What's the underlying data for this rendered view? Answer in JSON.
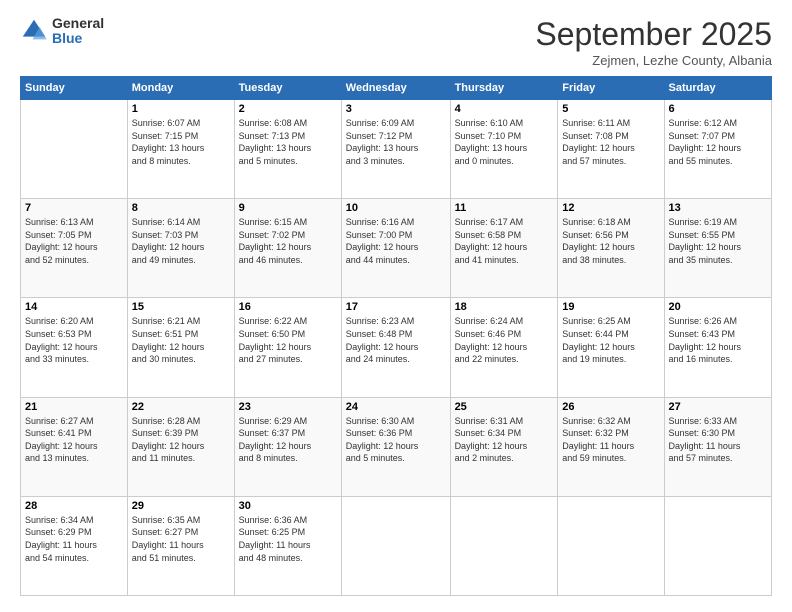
{
  "header": {
    "logo_general": "General",
    "logo_blue": "Blue",
    "month_title": "September 2025",
    "location": "Zejmen, Lezhe County, Albania"
  },
  "calendar": {
    "days_of_week": [
      "Sunday",
      "Monday",
      "Tuesday",
      "Wednesday",
      "Thursday",
      "Friday",
      "Saturday"
    ],
    "weeks": [
      [
        {
          "day": "",
          "info": ""
        },
        {
          "day": "1",
          "info": "Sunrise: 6:07 AM\nSunset: 7:15 PM\nDaylight: 13 hours\nand 8 minutes."
        },
        {
          "day": "2",
          "info": "Sunrise: 6:08 AM\nSunset: 7:13 PM\nDaylight: 13 hours\nand 5 minutes."
        },
        {
          "day": "3",
          "info": "Sunrise: 6:09 AM\nSunset: 7:12 PM\nDaylight: 13 hours\nand 3 minutes."
        },
        {
          "day": "4",
          "info": "Sunrise: 6:10 AM\nSunset: 7:10 PM\nDaylight: 13 hours\nand 0 minutes."
        },
        {
          "day": "5",
          "info": "Sunrise: 6:11 AM\nSunset: 7:08 PM\nDaylight: 12 hours\nand 57 minutes."
        },
        {
          "day": "6",
          "info": "Sunrise: 6:12 AM\nSunset: 7:07 PM\nDaylight: 12 hours\nand 55 minutes."
        }
      ],
      [
        {
          "day": "7",
          "info": "Sunrise: 6:13 AM\nSunset: 7:05 PM\nDaylight: 12 hours\nand 52 minutes."
        },
        {
          "day": "8",
          "info": "Sunrise: 6:14 AM\nSunset: 7:03 PM\nDaylight: 12 hours\nand 49 minutes."
        },
        {
          "day": "9",
          "info": "Sunrise: 6:15 AM\nSunset: 7:02 PM\nDaylight: 12 hours\nand 46 minutes."
        },
        {
          "day": "10",
          "info": "Sunrise: 6:16 AM\nSunset: 7:00 PM\nDaylight: 12 hours\nand 44 minutes."
        },
        {
          "day": "11",
          "info": "Sunrise: 6:17 AM\nSunset: 6:58 PM\nDaylight: 12 hours\nand 41 minutes."
        },
        {
          "day": "12",
          "info": "Sunrise: 6:18 AM\nSunset: 6:56 PM\nDaylight: 12 hours\nand 38 minutes."
        },
        {
          "day": "13",
          "info": "Sunrise: 6:19 AM\nSunset: 6:55 PM\nDaylight: 12 hours\nand 35 minutes."
        }
      ],
      [
        {
          "day": "14",
          "info": "Sunrise: 6:20 AM\nSunset: 6:53 PM\nDaylight: 12 hours\nand 33 minutes."
        },
        {
          "day": "15",
          "info": "Sunrise: 6:21 AM\nSunset: 6:51 PM\nDaylight: 12 hours\nand 30 minutes."
        },
        {
          "day": "16",
          "info": "Sunrise: 6:22 AM\nSunset: 6:50 PM\nDaylight: 12 hours\nand 27 minutes."
        },
        {
          "day": "17",
          "info": "Sunrise: 6:23 AM\nSunset: 6:48 PM\nDaylight: 12 hours\nand 24 minutes."
        },
        {
          "day": "18",
          "info": "Sunrise: 6:24 AM\nSunset: 6:46 PM\nDaylight: 12 hours\nand 22 minutes."
        },
        {
          "day": "19",
          "info": "Sunrise: 6:25 AM\nSunset: 6:44 PM\nDaylight: 12 hours\nand 19 minutes."
        },
        {
          "day": "20",
          "info": "Sunrise: 6:26 AM\nSunset: 6:43 PM\nDaylight: 12 hours\nand 16 minutes."
        }
      ],
      [
        {
          "day": "21",
          "info": "Sunrise: 6:27 AM\nSunset: 6:41 PM\nDaylight: 12 hours\nand 13 minutes."
        },
        {
          "day": "22",
          "info": "Sunrise: 6:28 AM\nSunset: 6:39 PM\nDaylight: 12 hours\nand 11 minutes."
        },
        {
          "day": "23",
          "info": "Sunrise: 6:29 AM\nSunset: 6:37 PM\nDaylight: 12 hours\nand 8 minutes."
        },
        {
          "day": "24",
          "info": "Sunrise: 6:30 AM\nSunset: 6:36 PM\nDaylight: 12 hours\nand 5 minutes."
        },
        {
          "day": "25",
          "info": "Sunrise: 6:31 AM\nSunset: 6:34 PM\nDaylight: 12 hours\nand 2 minutes."
        },
        {
          "day": "26",
          "info": "Sunrise: 6:32 AM\nSunset: 6:32 PM\nDaylight: 11 hours\nand 59 minutes."
        },
        {
          "day": "27",
          "info": "Sunrise: 6:33 AM\nSunset: 6:30 PM\nDaylight: 11 hours\nand 57 minutes."
        }
      ],
      [
        {
          "day": "28",
          "info": "Sunrise: 6:34 AM\nSunset: 6:29 PM\nDaylight: 11 hours\nand 54 minutes."
        },
        {
          "day": "29",
          "info": "Sunrise: 6:35 AM\nSunset: 6:27 PM\nDaylight: 11 hours\nand 51 minutes."
        },
        {
          "day": "30",
          "info": "Sunrise: 6:36 AM\nSunset: 6:25 PM\nDaylight: 11 hours\nand 48 minutes."
        },
        {
          "day": "",
          "info": ""
        },
        {
          "day": "",
          "info": ""
        },
        {
          "day": "",
          "info": ""
        },
        {
          "day": "",
          "info": ""
        }
      ]
    ]
  }
}
